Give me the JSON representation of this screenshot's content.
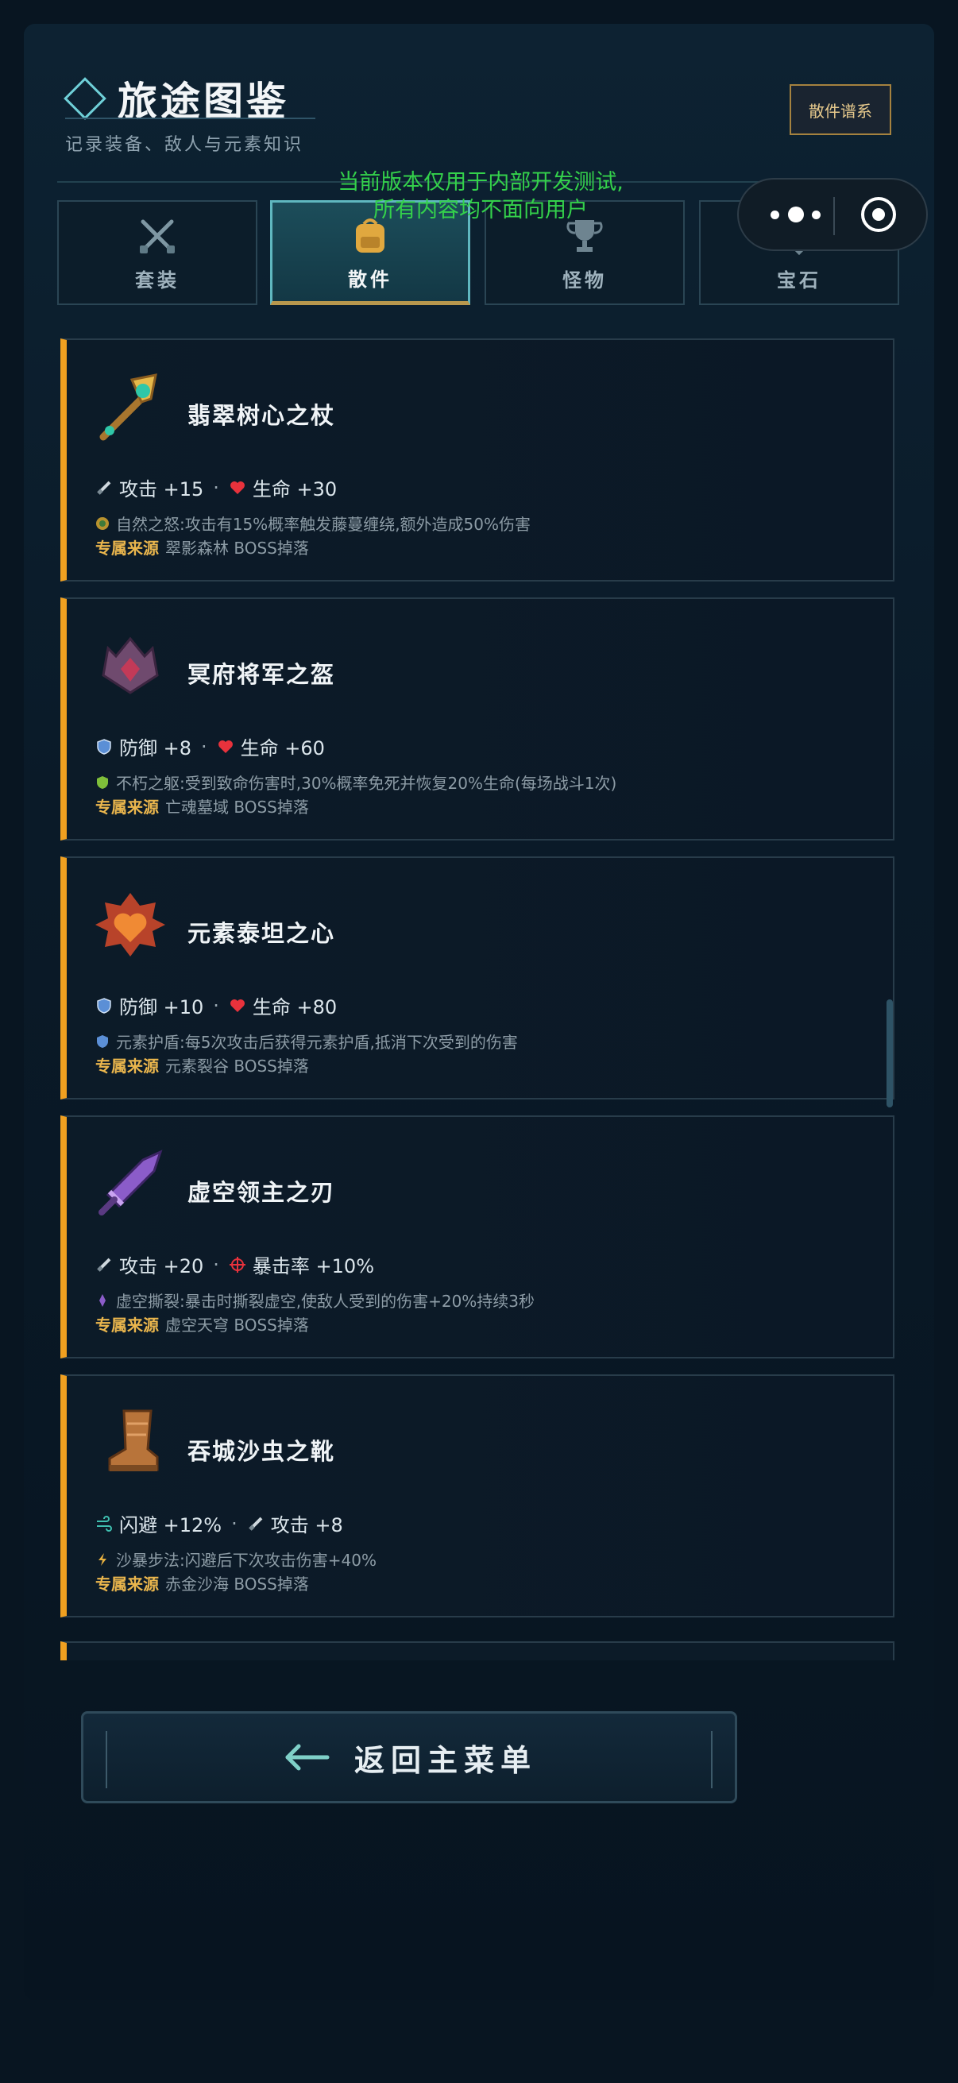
{
  "header": {
    "title": "旅途图鉴",
    "subtitle": "记录装备、敌人与元素知识",
    "system_button": "散件谱系",
    "dev_notice_line1": "当前版本仅用于内部开发测试,",
    "dev_notice_line2": "所有内容均不面向用户"
  },
  "tabs": [
    {
      "label": "套装",
      "icon": "crossed-swords-icon",
      "active": false
    },
    {
      "label": "散件",
      "icon": "backpack-icon",
      "active": true
    },
    {
      "label": "怪物",
      "icon": "trophy-icon",
      "active": false
    },
    {
      "label": "宝石",
      "icon": "gem-icon",
      "active": false
    }
  ],
  "items": [
    {
      "name": "翡翠树心之杖",
      "icon": "emerald-staff-icon",
      "stats": [
        {
          "icon": "sword-icon",
          "text": "攻击 +15"
        },
        {
          "icon": "heart-icon",
          "text": "生命 +30"
        }
      ],
      "effect_icon": "nature-icon",
      "effect": "自然之怒:攻击有15%概率触发藤蔓缠绕,额外造成50%伤害",
      "source_tag": "专属来源",
      "source": "翠影森林 BOSS掉落"
    },
    {
      "name": "冥府将军之盔",
      "icon": "underworld-helm-icon",
      "stats": [
        {
          "icon": "shield-icon",
          "text": "防御 +8"
        },
        {
          "icon": "heart-icon",
          "text": "生命 +60"
        }
      ],
      "effect_icon": "green-shield-icon",
      "effect": "不朽之躯:受到致命伤害时,30%概率免死并恢复20%生命(每场战斗1次)",
      "source_tag": "专属来源",
      "source": "亡魂墓域 BOSS掉落"
    },
    {
      "name": "元素泰坦之心",
      "icon": "titan-heart-icon",
      "stats": [
        {
          "icon": "shield-icon",
          "text": "防御 +10"
        },
        {
          "icon": "heart-icon",
          "text": "生命 +80"
        }
      ],
      "effect_icon": "shield-icon",
      "effect": "元素护盾:每5次攻击后获得元素护盾,抵消下次受到的伤害",
      "source_tag": "专属来源",
      "source": "元素裂谷 BOSS掉落"
    },
    {
      "name": "虚空领主之刃",
      "icon": "void-blade-icon",
      "stats": [
        {
          "icon": "sword-icon",
          "text": "攻击 +20"
        },
        {
          "icon": "crosshair-icon",
          "text": "暴击率 +10%"
        }
      ],
      "effect_icon": "void-icon",
      "effect": "虚空撕裂:暴击时撕裂虚空,使敌人受到的伤害+20%持续3秒",
      "source_tag": "专属来源",
      "source": "虚空天穹 BOSS掉落"
    },
    {
      "name": "吞城沙虫之靴",
      "icon": "sandworm-boots-icon",
      "stats": [
        {
          "icon": "wind-icon",
          "text": "闪避 +12%"
        },
        {
          "icon": "sword-icon",
          "text": "攻击 +8"
        }
      ],
      "effect_icon": "lightning-icon",
      "effect": "沙暴步法:闪避后下次攻击伤害+40%",
      "source_tag": "专属来源",
      "source": "赤金沙海 BOSS掉落"
    }
  ],
  "back_button": {
    "label": "返回主菜单",
    "icon": "back-arrow-icon"
  },
  "colors": {
    "accent": "#f0a020",
    "teal": "#5fb7bf",
    "gold": "#b8974d",
    "dev_text": "#34d14b"
  }
}
